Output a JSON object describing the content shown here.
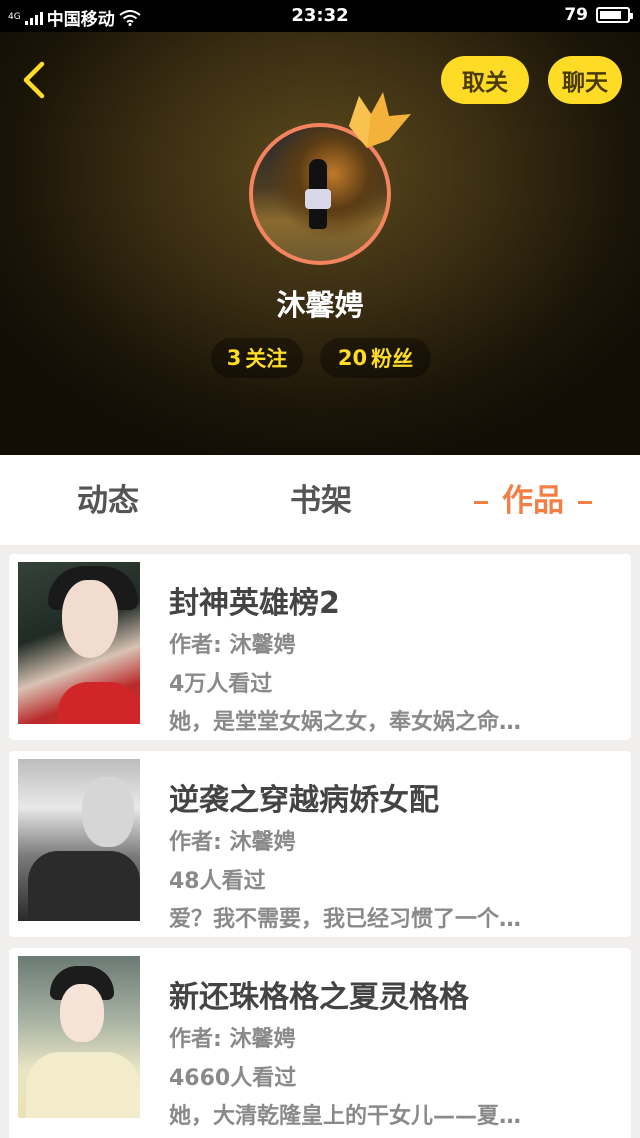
{
  "status_bar": {
    "network": "4G",
    "carrier": "中国移动",
    "time": "23:32",
    "battery_level": "79",
    "battery_fraction": 0.79
  },
  "header": {
    "unfollow_label": "取关",
    "chat_label": "聊天",
    "name": "沐馨娉",
    "following_count": "3",
    "following_label": "关注",
    "fans_count": "20",
    "fans_label": "粉丝"
  },
  "tabs": [
    {
      "label": "动态",
      "selected": false
    },
    {
      "label": "书架",
      "selected": false
    },
    {
      "label": "作品",
      "selected": true
    }
  ],
  "works": [
    {
      "title": "封神英雄榜2",
      "author": "作者: 沐馨娉",
      "views": "4万人看过",
      "description": "她，是堂堂女娲之女，奉女娲之命…"
    },
    {
      "title": "逆袭之穿越病娇女配",
      "author": "作者: 沐馨娉",
      "views": "48人看过",
      "description": "爱？我不需要，我已经习惯了一个…"
    },
    {
      "title": "新还珠格格之夏灵格格",
      "author": "作者: 沐馨娉",
      "views": "4660人看过",
      "description": "她，大清乾隆皇上的干女儿——夏…"
    }
  ],
  "colors": {
    "accent_yellow": "#fedc25",
    "accent_orange": "#f37f45",
    "avatar_ring": "#f4845f"
  }
}
